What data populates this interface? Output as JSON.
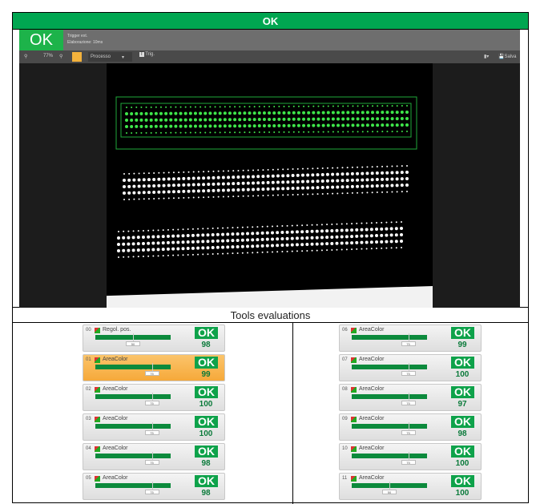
{
  "header": {
    "status": "OK"
  },
  "app": {
    "result": "OK",
    "trigger": "Trigger ext.",
    "elaboration": "Elaborazione: 10ms",
    "zoom": "77%",
    "process_select": "Processo",
    "trig_label": "Trig.",
    "save_label": "Salva"
  },
  "section_title": "Tools evaluations",
  "tools": [
    {
      "id": "00",
      "name": "Regol. pos.",
      "threshold": "50",
      "status": "OK",
      "value": "98",
      "selected": false
    },
    {
      "id": "01",
      "name": "AreaColor",
      "threshold": "75",
      "status": "OK",
      "value": "99",
      "selected": true
    },
    {
      "id": "02",
      "name": "AreaColor",
      "threshold": "75",
      "status": "OK",
      "value": "100",
      "selected": false
    },
    {
      "id": "03",
      "name": "AreaColor",
      "threshold": "75",
      "status": "OK",
      "value": "100",
      "selected": false
    },
    {
      "id": "04",
      "name": "AreaColor",
      "threshold": "75",
      "status": "OK",
      "value": "98",
      "selected": false
    },
    {
      "id": "05",
      "name": "AreaColor",
      "threshold": "75",
      "status": "OK",
      "value": "98",
      "selected": false
    },
    {
      "id": "06",
      "name": "AreaColor",
      "threshold": "75",
      "status": "OK",
      "value": "99",
      "selected": false
    },
    {
      "id": "07",
      "name": "AreaColor",
      "threshold": "75",
      "status": "OK",
      "value": "100",
      "selected": false
    },
    {
      "id": "08",
      "name": "AreaColor",
      "threshold": "75",
      "status": "OK",
      "value": "97",
      "selected": false
    },
    {
      "id": "09",
      "name": "AreaColor",
      "threshold": "75",
      "status": "OK",
      "value": "98",
      "selected": false
    },
    {
      "id": "10",
      "name": "AreaColor",
      "threshold": "75",
      "status": "OK",
      "value": "100",
      "selected": false
    },
    {
      "id": "11",
      "name": "AreaColor",
      "threshold": "50",
      "status": "OK",
      "value": "100",
      "selected": false
    }
  ],
  "colors": {
    "ok_green": "#00a651",
    "selected": "#f6a93a"
  }
}
